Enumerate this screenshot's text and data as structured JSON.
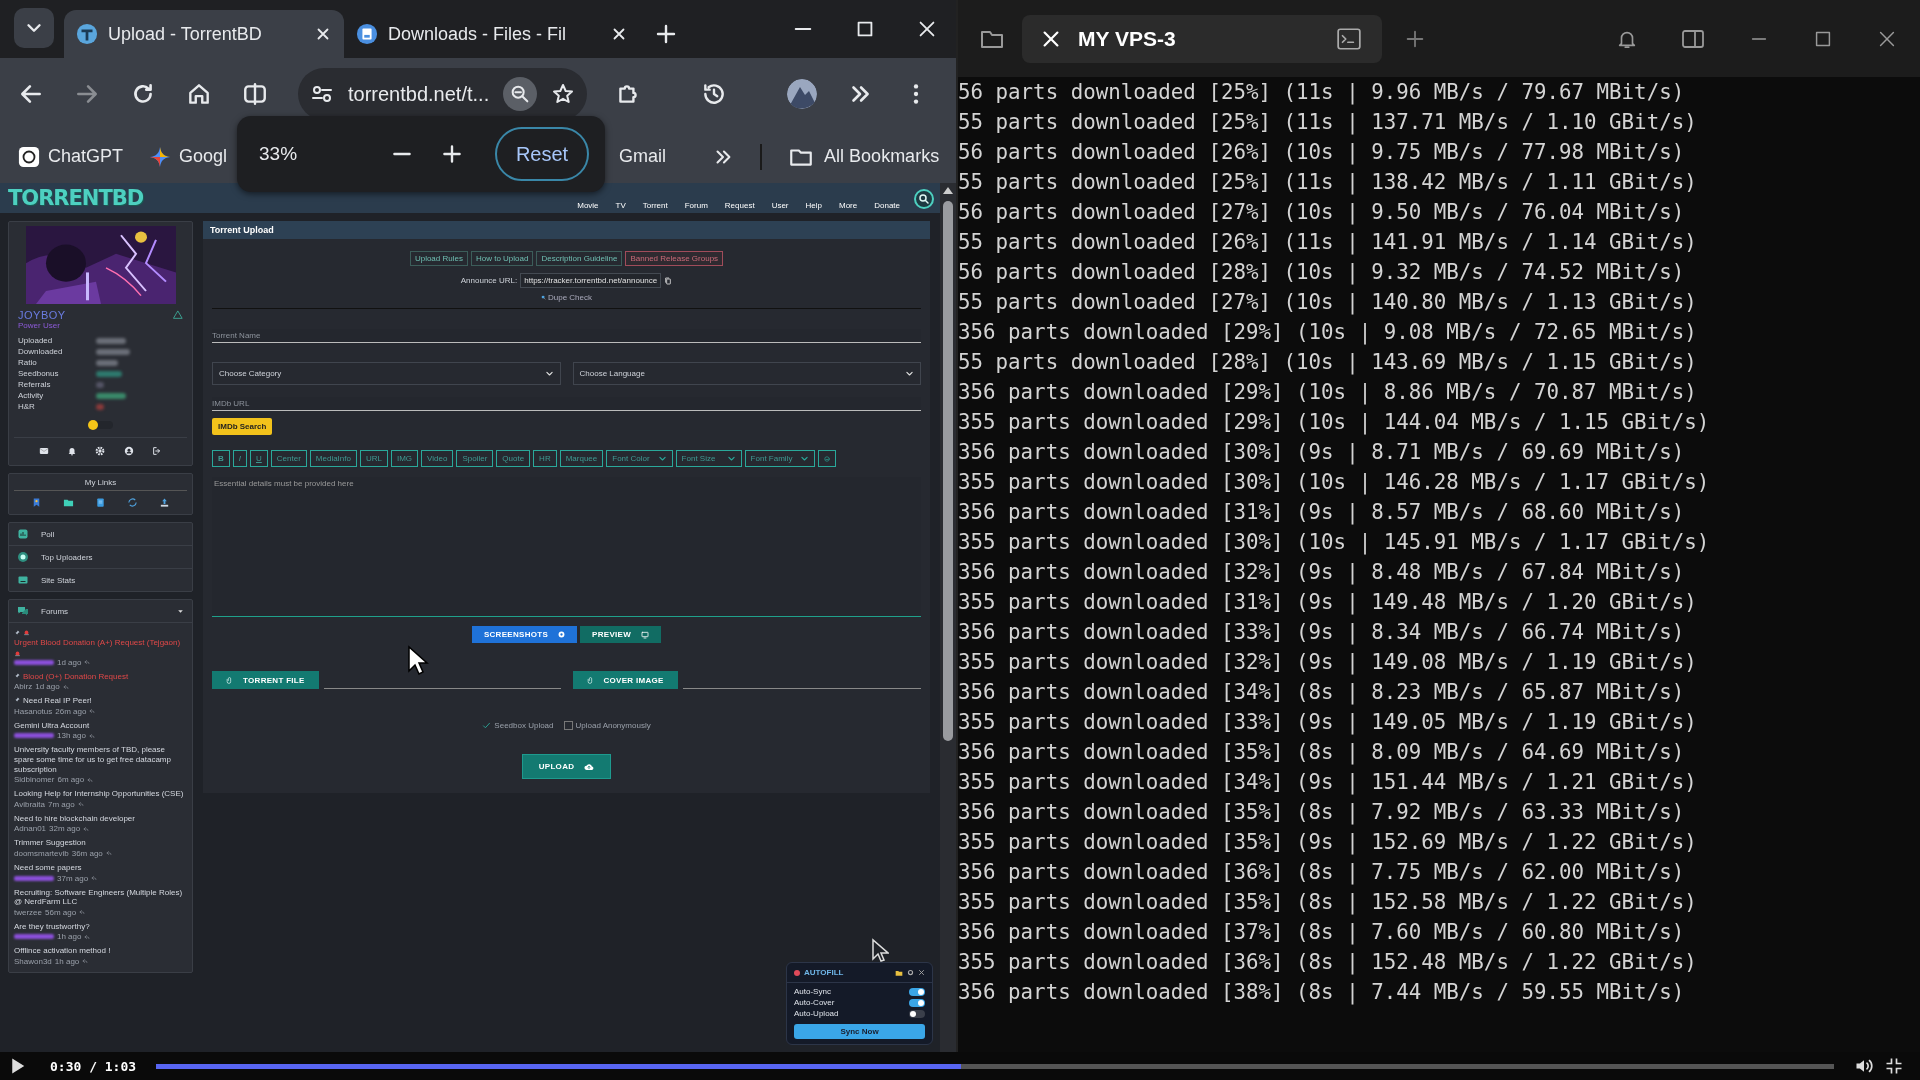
{
  "browser": {
    "tabs": [
      {
        "title": "Upload - TorrentBD",
        "selected": true
      },
      {
        "title": "Downloads - Files - Fil",
        "selected": false
      }
    ],
    "address": "torrentbd.net/t...",
    "bookmarks": [
      "ChatGPT",
      "Googl",
      "Gmail"
    ],
    "all_bookmarks": "All Bookmarks",
    "zoom_popup": {
      "value": "33%",
      "reset": "Reset"
    }
  },
  "site": {
    "logo": "TORRENTBD",
    "nav": [
      "Movie",
      "TV",
      "Torrent",
      "Forum",
      "Request",
      "User",
      "Help",
      "More",
      "Donate"
    ],
    "profile": {
      "username": "JOYBOY",
      "rank": "Power User",
      "stats": [
        "Uploaded",
        "Downloaded",
        "Ratio",
        "Seedbonus",
        "Referrals",
        "Activity",
        "H&R"
      ]
    },
    "my_links": "My Links",
    "menu": [
      "Poll",
      "Top Uploaders",
      "Site Stats"
    ],
    "forums": {
      "title": "Forums",
      "posts": [
        {
          "title": "Urgent Blood Donation (A+) Request (Tejgaon)",
          "kind": "urgent",
          "author_blurred": true,
          "time": "1d ago"
        },
        {
          "title": "Blood (O+) Donation Request",
          "kind": "request",
          "author": "Abirz",
          "author_blurred": false,
          "time": "1d ago"
        },
        {
          "title": "Need Real IP Peer!",
          "kind": "pinned",
          "author": "Hasanotus",
          "author_blurred": false,
          "time": "26m ago"
        },
        {
          "title": "Gemini Ultra Account",
          "kind": "normal",
          "author_blurred": true,
          "time": "13h ago"
        },
        {
          "title": "University faculty members of TBD, please spare some time for us to get free datacamp subscription",
          "kind": "normal",
          "author": "Sidbinomer",
          "author_blurred": false,
          "time": "6m ago"
        },
        {
          "title": "Looking Help for Internship Opportunities (CSE)",
          "kind": "normal",
          "author": "Avibraita",
          "author_blurred": false,
          "time": "7m ago"
        },
        {
          "title": "Need to hire blockchain developer",
          "kind": "normal",
          "author": "Adnan01",
          "author_blurred": false,
          "time": "32m ago"
        },
        {
          "title": "Trimmer Suggestion",
          "kind": "normal",
          "author": "doomsmartevib",
          "author_blurred": false,
          "time": "36m ago"
        },
        {
          "title": "Need some papers",
          "kind": "normal",
          "author_blurred": true,
          "time": "37m ago"
        },
        {
          "title": "Recruiting: Software Engineers (Multiple Roles) @ NerdFarm LLC",
          "kind": "normal",
          "author": "twerzee",
          "author_blurred": false,
          "time": "56m ago"
        },
        {
          "title": "Are they trustworthy?",
          "kind": "normal",
          "author_blurred": true,
          "time": "1h ago"
        },
        {
          "title": "Offlince activation method !",
          "kind": "normal",
          "author": "Shawon3d",
          "author_blurred": false,
          "time": "1h ago"
        }
      ]
    },
    "upload": {
      "title": "Torrent Upload",
      "guide_buttons": [
        {
          "label": "Upload Rules",
          "kind": "normal"
        },
        {
          "label": "How to Upload",
          "kind": "normal"
        },
        {
          "label": "Description Guideline",
          "kind": "normal"
        },
        {
          "label": "Banned Release Groups",
          "kind": "danger"
        }
      ],
      "announce_label": "Announce URL:",
      "announce_url": "https://tracker.torrentbd.net/announce",
      "dupe_check": "Dupe Check",
      "torrent_name": {
        "placeholder": "Torrent Name"
      },
      "category": {
        "placeholder": "Choose Category"
      },
      "language": {
        "placeholder": "Choose Language"
      },
      "imdb": {
        "placeholder": "IMDb URL"
      },
      "imdb_search": "IMDb Search",
      "toolbar": [
        {
          "label": "B",
          "kind": "bold"
        },
        {
          "label": "I",
          "kind": "italic"
        },
        {
          "label": "U",
          "kind": "underline"
        },
        {
          "label": "Center",
          "kind": "text"
        },
        {
          "label": "MediaInfo",
          "kind": "text"
        },
        {
          "label": "URL",
          "kind": "text"
        },
        {
          "label": "IMG",
          "kind": "text"
        },
        {
          "label": "Video",
          "kind": "text"
        },
        {
          "label": "Spoiler",
          "kind": "text"
        },
        {
          "label": "Quote",
          "kind": "text"
        },
        {
          "label": "HR",
          "kind": "text"
        },
        {
          "label": "Marquee",
          "kind": "text"
        },
        {
          "label": "Font Color",
          "kind": "select"
        },
        {
          "label": "Font Size",
          "kind": "select"
        },
        {
          "label": "Font Family",
          "kind": "select"
        },
        {
          "kind": "emoji"
        }
      ],
      "description": {
        "placeholder": "Essential details must be provided here"
      },
      "screenshots": "SCREENSHOTS",
      "preview": "PREVIEW",
      "torrent_file": "TORRENT FILE",
      "cover_image": "COVER IMAGE",
      "options": [
        {
          "label": "Seedbox Upload",
          "checked": true
        },
        {
          "label": "Upload Anonymously",
          "checked": false
        }
      ],
      "upload_button": "UPLOAD"
    }
  },
  "autofill": {
    "title": "AUTOFILL",
    "toggles": [
      {
        "label": "Auto-Sync",
        "on": true
      },
      {
        "label": "Auto-Cover",
        "on": true
      },
      {
        "label": "Auto-Upload",
        "on": false
      }
    ],
    "button": "Sync Now"
  },
  "terminal": {
    "tab": "MY VPS-3",
    "lines": [
      "56 parts downloaded [25%] (11s | 9.96 MB/s / 79.67 MBit/s)",
      "55 parts downloaded [25%] (11s | 137.71 MB/s / 1.10 GBit/s)",
      "56 parts downloaded [26%] (10s | 9.75 MB/s / 77.98 MBit/s)",
      "55 parts downloaded [25%] (11s | 138.42 MB/s / 1.11 GBit/s)",
      "56 parts downloaded [27%] (10s | 9.50 MB/s / 76.04 MBit/s)",
      "55 parts downloaded [26%] (11s | 141.91 MB/s / 1.14 GBit/s)",
      "56 parts downloaded [28%] (10s | 9.32 MB/s / 74.52 MBit/s)",
      "55 parts downloaded [27%] (10s | 140.80 MB/s / 1.13 GBit/s)",
      "356 parts downloaded [29%] (10s | 9.08 MB/s / 72.65 MBit/s)",
      "55 parts downloaded [28%] (10s | 143.69 MB/s / 1.15 GBit/s)",
      "356 parts downloaded [29%] (10s | 8.86 MB/s / 70.87 MBit/s)",
      "355 parts downloaded [29%] (10s | 144.04 MB/s / 1.15 GBit/s)",
      "356 parts downloaded [30%] (9s | 8.71 MB/s / 69.69 MBit/s)",
      "355 parts downloaded [30%] (10s | 146.28 MB/s / 1.17 GBit/s)",
      "356 parts downloaded [31%] (9s | 8.57 MB/s / 68.60 MBit/s)",
      "355 parts downloaded [30%] (10s | 145.91 MB/s / 1.17 GBit/s)",
      "356 parts downloaded [32%] (9s | 8.48 MB/s / 67.84 MBit/s)",
      "355 parts downloaded [31%] (9s | 149.48 MB/s / 1.20 GBit/s)",
      "356 parts downloaded [33%] (9s | 8.34 MB/s / 66.74 MBit/s)",
      "355 parts downloaded [32%] (9s | 149.08 MB/s / 1.19 GBit/s)",
      "356 parts downloaded [34%] (8s | 8.23 MB/s / 65.87 MBit/s)",
      "355 parts downloaded [33%] (9s | 149.05 MB/s / 1.19 GBit/s)",
      "356 parts downloaded [35%] (8s | 8.09 MB/s / 64.69 MBit/s)",
      "355 parts downloaded [34%] (9s | 151.44 MB/s / 1.21 GBit/s)",
      "356 parts downloaded [35%] (8s | 7.92 MB/s / 63.33 MBit/s)",
      "355 parts downloaded [35%] (9s | 152.69 MB/s / 1.22 GBit/s)",
      "356 parts downloaded [36%] (8s | 7.75 MB/s / 62.00 MBit/s)",
      "355 parts downloaded [35%] (8s | 152.58 MB/s / 1.22 GBit/s)",
      "356 parts downloaded [37%] (8s | 7.60 MB/s / 60.80 MBit/s)",
      "355 parts downloaded [36%] (8s | 152.48 MB/s / 1.22 GBit/s)",
      "356 parts downloaded [38%] (8s | 7.44 MB/s / 59.55 MBit/s)"
    ]
  },
  "video": {
    "time": "0:30 / 1:03",
    "level": 0.48
  }
}
